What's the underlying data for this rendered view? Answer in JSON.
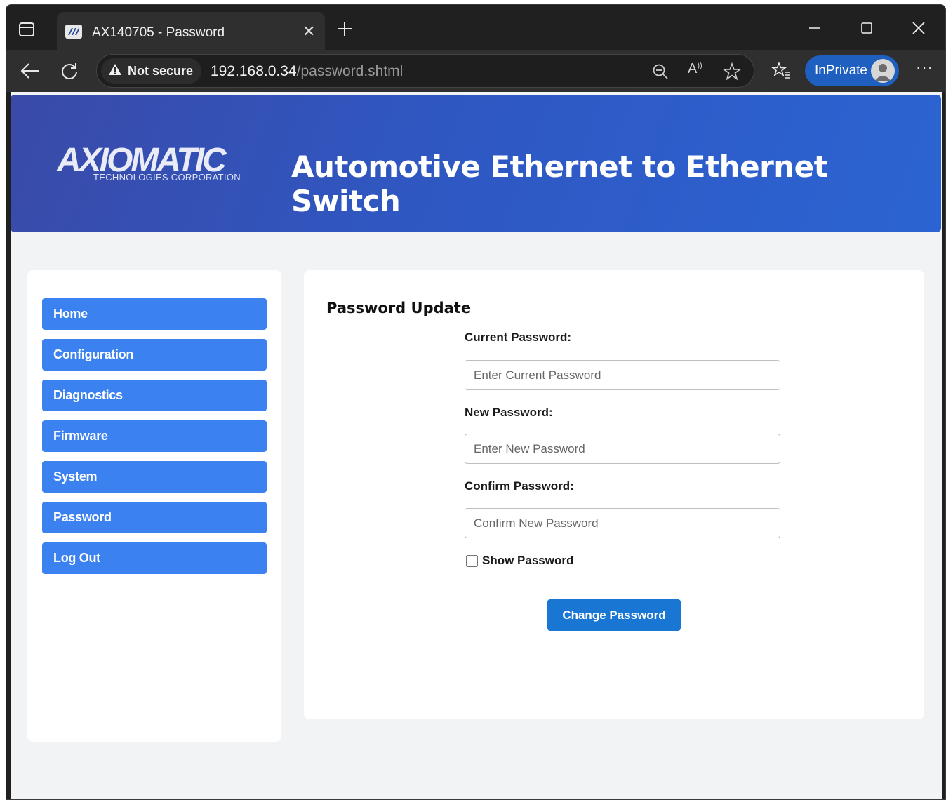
{
  "browser": {
    "tab_title": "AX140705 - Password",
    "security_label": "Not secure",
    "url_host": "192.168.0.34",
    "url_path": "/password.shtml",
    "inprivate_label": "InPrivate"
  },
  "header": {
    "logo_text": "AXIOMATIC",
    "logo_subtext": "TECHNOLOGIES CORPORATION",
    "title": "Automotive Ethernet to Ethernet Switch"
  },
  "sidebar": {
    "items": [
      {
        "label": "Home"
      },
      {
        "label": "Configuration"
      },
      {
        "label": "Diagnostics"
      },
      {
        "label": "Firmware"
      },
      {
        "label": "System"
      },
      {
        "label": "Password"
      },
      {
        "label": "Log Out"
      }
    ]
  },
  "form": {
    "section_title": "Password Update",
    "current_label": "Current Password:",
    "current_placeholder": "Enter Current Password",
    "current_value": "",
    "new_label": "New Password:",
    "new_placeholder": "Enter New Password",
    "new_value": "",
    "confirm_label": "Confirm Password:",
    "confirm_placeholder": "Confirm New Password",
    "confirm_value": "",
    "show_password_label": "Show Password",
    "show_password_checked": false,
    "submit_label": "Change Password"
  },
  "colors": {
    "header_start": "#3a4aa8",
    "header_end": "#2b64d2",
    "nav_button": "#3b82f0",
    "submit_button": "#1976d2",
    "inprivate_badge": "#1f5fbf"
  },
  "icons": {
    "tab_actions": "tab-actions-icon",
    "favicon": "axiomatic-favicon",
    "tab_close": "close-icon",
    "new_tab": "plus-icon",
    "back": "back-arrow-icon",
    "refresh": "refresh-icon",
    "warning": "warning-icon",
    "zoom": "zoom-out-icon",
    "read_aloud": "read-aloud-icon",
    "favorite": "star-icon",
    "favorites_bar": "favorites-icon",
    "more": "more-icon"
  }
}
